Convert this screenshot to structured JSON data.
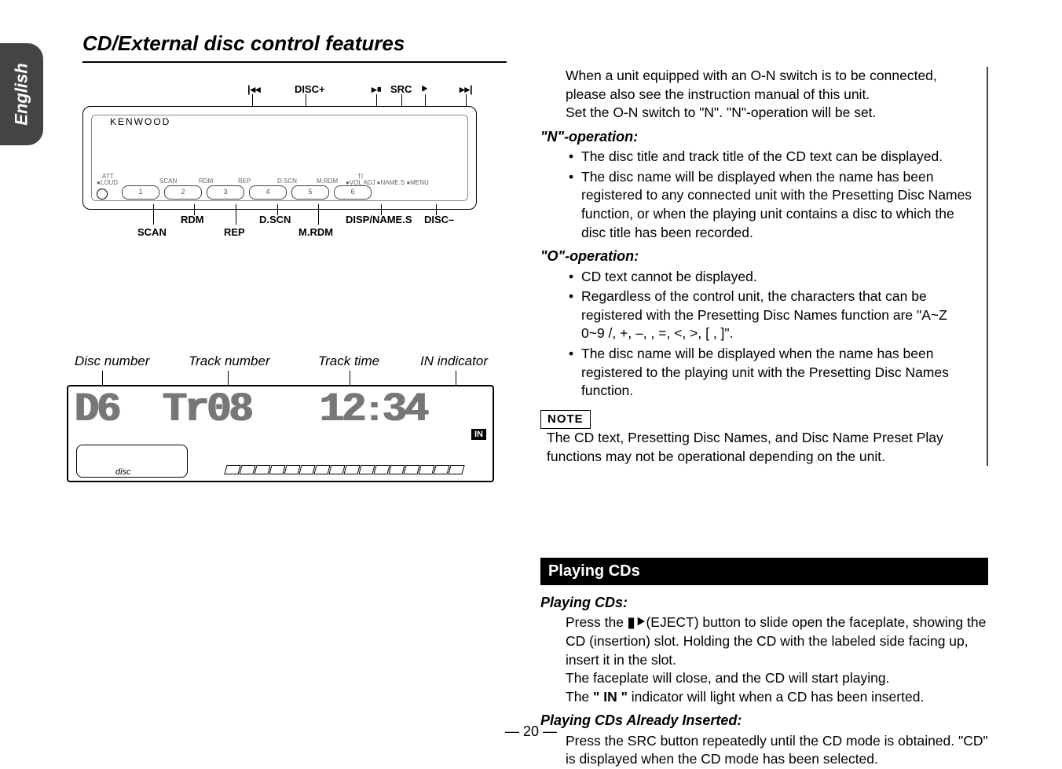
{
  "sideTab": "English",
  "title": "CD/External disc control features",
  "device": {
    "brand": "KENWOOD",
    "topLabels": {
      "prev": "|◂◂",
      "discPlus": "DISC+",
      "playPause": "▸⏸",
      "src": "SRC",
      "eject": "⯈",
      "next": "▸▸|"
    },
    "bottomRow1": {
      "scan": "SCAN",
      "rdm": "RDM",
      "rep": "REP",
      "dscn": "D.SCN",
      "mrdm": "M.RDM",
      "dispnames": "DISP/NAME.S",
      "discMinus": "DISC–"
    },
    "smallBtns": [
      "1",
      "2",
      "3",
      "4",
      "5",
      "6"
    ],
    "tinyLabels": [
      "ATT",
      "●LOUD",
      "SCAN",
      "RDM",
      "REP",
      "D.SCN",
      "M.RDM",
      "TI",
      "●VOL ADJ ●NAME.S ●MENU"
    ]
  },
  "display": {
    "labels": {
      "disc": "Disc number",
      "track": "Track number",
      "time": "Track time",
      "in": "IN indicator"
    },
    "discTxt": "disc",
    "inTag": "IN"
  },
  "text": {
    "intro1": "When a unit equipped with an O-N switch is to be connected, please also see the instruction manual of this unit.",
    "intro2": "Set the O-N switch to \"N\". \"N\"-operation will be set.",
    "nHead": "\"N\"-operation:",
    "n1": "The disc title and track title of the CD text can be displayed.",
    "n2": "The disc name will be displayed when the name has been registered to any connected unit with the Presetting Disc Names function, or when the playing unit contains a disc to which the disc title has been recorded.",
    "oHead": "\"O\"-operation:",
    "o1": "CD text cannot be displayed.",
    "o2": "Regardless of the control unit, the characters that can be registered with the Presetting Disc Names function are \"A~Z  0~9  /, +, –,   , =, <, >, [ , ]\".",
    "o3": "The disc name will be displayed when the name has been registered to the playing unit with the Presetting Disc Names function.",
    "noteLabel": "NOTE",
    "noteText": "The CD text, Presetting Disc Names, and Disc Name Preset Play functions may not be operational depending on the unit.",
    "playingBar": "Playing CDs",
    "pcHead": "Playing CDs:",
    "pc1a": "Press the ",
    "pc1b": "(EJECT) button to slide open the faceplate, showing the CD (insertion) slot.  Holding the CD with the labeled side facing up, insert it in the slot.",
    "pc2": "The faceplate will close, and the CD will start playing.",
    "pc3a": "The ",
    "pc3b": " indicator will light when a CD has been inserted.",
    "paHead": "Playing CDs Already Inserted:",
    "pa1": "Press the SRC button repeatedly until the CD mode is obtained. \"CD\" is displayed when the CD mode has been selected.",
    "inIndicator": "IN",
    "ejectGlyph": "▮⯈"
  },
  "pageNum": "— 20 —"
}
